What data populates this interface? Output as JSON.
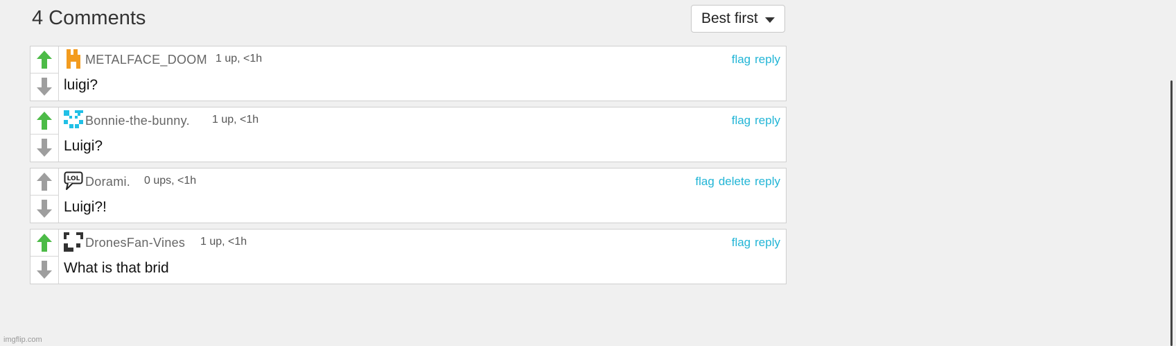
{
  "header": {
    "title": "4 Comments",
    "sort_label": "Best first"
  },
  "comments": [
    {
      "username": "METALFACE_DOOM",
      "meta": "1 up, <1h",
      "text": "luigi?",
      "actions": [
        "flag",
        "reply"
      ],
      "upvoted": true,
      "avatar_icon": "orange-pixel-avatar-icon",
      "avatar_color": "#f39c1f"
    },
    {
      "username": "Bonnie-the-bunny.",
      "meta": "1 up, <1h",
      "text": "Luigi?",
      "actions": [
        "flag",
        "reply"
      ],
      "upvoted": true,
      "avatar_icon": "cyan-pixel-avatar-icon",
      "avatar_color": "#21c0e6"
    },
    {
      "username": "Dorami.",
      "meta": "0 ups, <1h",
      "text": "Luigi?!",
      "actions": [
        "flag",
        "delete",
        "reply"
      ],
      "upvoted": false,
      "avatar_icon": "lol-speech-bubble-icon",
      "avatar_color": "#222222"
    },
    {
      "username": "DronesFan-Vines",
      "meta": "1 up, <1h",
      "text": "What is that brid",
      "actions": [
        "flag",
        "reply"
      ],
      "upvoted": true,
      "avatar_icon": "black-pixel-avatar-icon",
      "avatar_color": "#333333"
    }
  ],
  "footer": {
    "brand": "imgflip.com"
  },
  "colors": {
    "upvote_active": "#4cbb47",
    "vote_inactive": "#9e9e9e",
    "link": "#22b5d6"
  }
}
